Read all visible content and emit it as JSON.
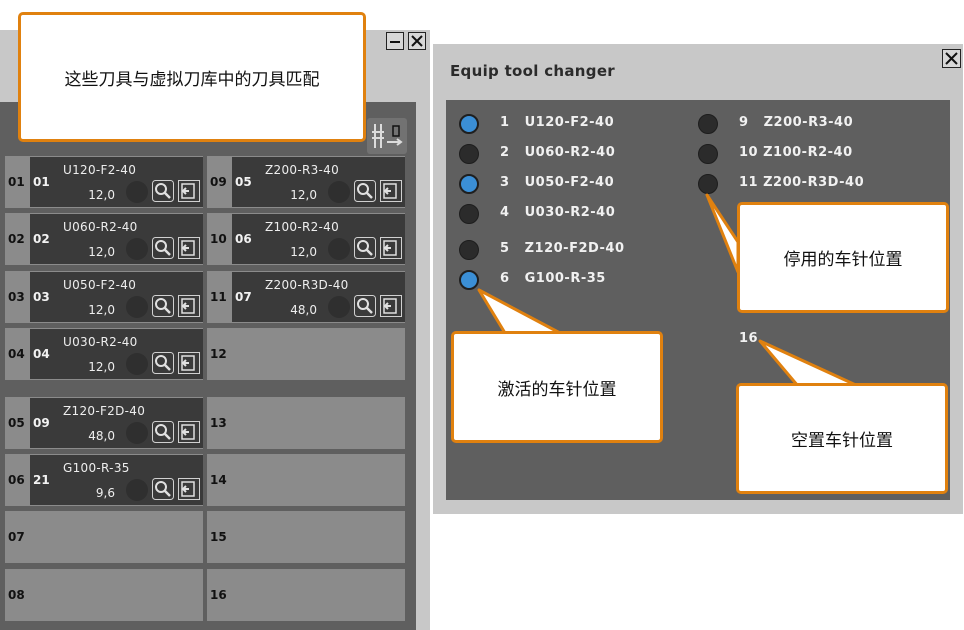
{
  "magazine": {
    "slots": [
      {
        "pos": "01",
        "tool": {
          "num": "01",
          "name": "U120-F2-40",
          "value": "12,0"
        }
      },
      {
        "pos": "02",
        "tool": {
          "num": "02",
          "name": "U060-R2-40",
          "value": "12,0"
        }
      },
      {
        "pos": "03",
        "tool": {
          "num": "03",
          "name": "U050-F2-40",
          "value": "12,0"
        }
      },
      {
        "pos": "04",
        "tool": {
          "num": "04",
          "name": "U030-R2-40",
          "value": "12,0"
        }
      },
      {
        "pos": "05",
        "tool": {
          "num": "09",
          "name": "Z120-F2D-40",
          "value": "48,0"
        }
      },
      {
        "pos": "06",
        "tool": {
          "num": "21",
          "name": "G100-R-35",
          "value": "9,6"
        }
      },
      {
        "pos": "07",
        "tool": null
      },
      {
        "pos": "08",
        "tool": null
      },
      {
        "pos": "09",
        "tool": {
          "num": "05",
          "name": "Z200-R3-40",
          "value": "12,0"
        }
      },
      {
        "pos": "10",
        "tool": {
          "num": "06",
          "name": "Z100-R2-40",
          "value": "12,0"
        }
      },
      {
        "pos": "11",
        "tool": {
          "num": "07",
          "name": "Z200-R3D-40",
          "value": "48,0"
        }
      },
      {
        "pos": "12",
        "tool": null
      },
      {
        "pos": "13",
        "tool": null
      },
      {
        "pos": "14",
        "tool": null
      },
      {
        "pos": "15",
        "tool": null
      },
      {
        "pos": "16",
        "tool": null
      }
    ]
  },
  "changer": {
    "title": "Equip tool changer",
    "pins": [
      {
        "label": "1   U120-F2-40",
        "active": true
      },
      {
        "label": "2   U060-R2-40",
        "active": false
      },
      {
        "label": "3   U050-F2-40",
        "active": true
      },
      {
        "label": "4   U030-R2-40",
        "active": false
      },
      {
        "label": "5   Z120-F2D-40",
        "active": false
      },
      {
        "label": "6   G100-R-35",
        "active": true
      },
      {
        "label": "9   Z200-R3-40",
        "active": false
      },
      {
        "label": "10 Z100-R2-40",
        "active": false
      },
      {
        "label": "11 Z200-R3D-40",
        "active": false
      }
    ],
    "empty_label": "16"
  },
  "callouts": {
    "match": "这些刀具与虚拟刀库中的刀具匹配",
    "disabled": "停用的车针位置",
    "active": "激活的车针位置",
    "empty": "空置车针位置"
  },
  "colors": {
    "accent_orange": "#e0810f",
    "active_pin": "#3b8fd6",
    "panel": "#5f5f5f",
    "tool_bg": "#3a3a3a"
  },
  "icons": [
    "minimize-icon",
    "close-icon",
    "magazine-settings-icon",
    "search-tool-icon",
    "unload-tool-icon"
  ]
}
